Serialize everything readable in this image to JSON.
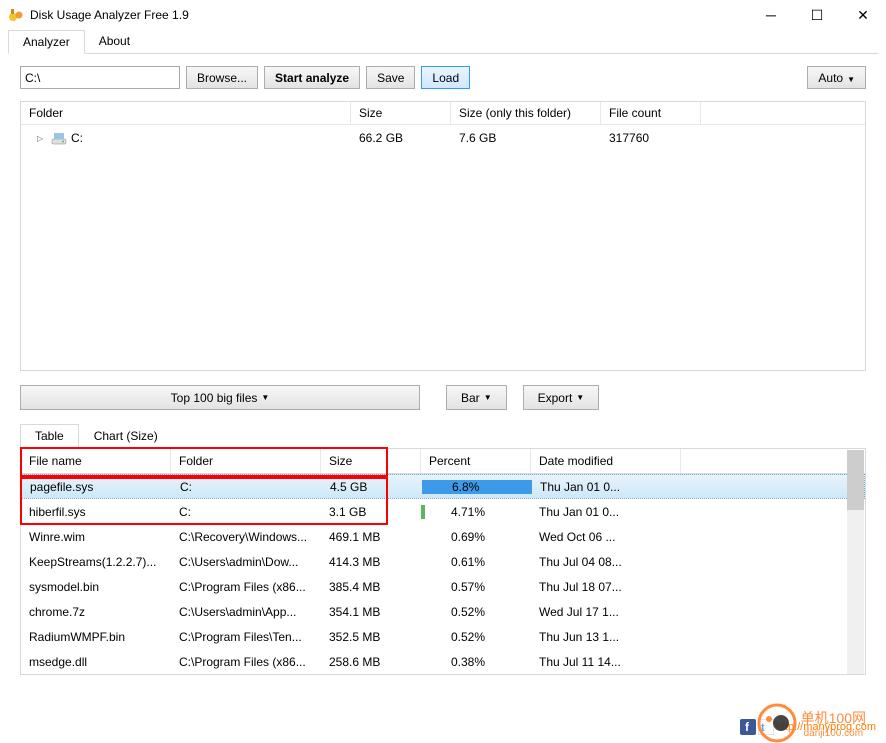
{
  "title": "Disk Usage Analyzer Free 1.9",
  "tabs": {
    "analyzer": "Analyzer",
    "about": "About"
  },
  "toolbar": {
    "path": "C:\\",
    "browse": "Browse...",
    "start": "Start analyze",
    "save": "Save",
    "load": "Load",
    "auto": "Auto"
  },
  "tree": {
    "headers": [
      "Folder",
      "Size",
      "Size (only this folder)",
      "File count"
    ],
    "rows": [
      {
        "name": "C:",
        "size": "66.2 GB",
        "own": "7.6 GB",
        "count": "317760"
      }
    ]
  },
  "mid": {
    "top100": "Top 100 big files",
    "bar": "Bar",
    "export": "Export"
  },
  "subtabs": {
    "table": "Table",
    "chart": "Chart (Size)"
  },
  "table": {
    "headers": {
      "fn": "File name",
      "fo": "Folder",
      "sz": "Size",
      "pc": "Percent",
      "dt": "Date modified"
    },
    "rows": [
      {
        "fn": "pagefile.sys",
        "fo": "C:",
        "sz": "4.5 GB",
        "pc": "6.8%",
        "pcw": 100,
        "bar": "blue",
        "dt": "Thu Jan 01 0...",
        "sel": true
      },
      {
        "fn": "hiberfil.sys",
        "fo": "C:",
        "sz": "3.1 GB",
        "pc": "4.71%",
        "pcw": 4,
        "bar": "green",
        "dt": "Thu Jan 01 0..."
      },
      {
        "fn": "Winre.wim",
        "fo": "C:\\Recovery\\Windows...",
        "sz": "469.1 MB",
        "pc": "0.69%",
        "pcw": 0,
        "dt": "Wed Oct 06 ..."
      },
      {
        "fn": "KeepStreams(1.2.2.7)...",
        "fo": "C:\\Users\\admin\\Dow...",
        "sz": "414.3 MB",
        "pc": "0.61%",
        "pcw": 0,
        "dt": "Thu Jul 04 08..."
      },
      {
        "fn": "sysmodel.bin",
        "fo": "C:\\Program Files (x86...",
        "sz": "385.4 MB",
        "pc": "0.57%",
        "pcw": 0,
        "dt": "Thu Jul 18 07..."
      },
      {
        "fn": "chrome.7z",
        "fo": "C:\\Users\\admin\\App...",
        "sz": "354.1 MB",
        "pc": "0.52%",
        "pcw": 0,
        "dt": "Wed Jul 17 1..."
      },
      {
        "fn": "RadiumWMPF.bin",
        "fo": "C:\\Program Files\\Ten...",
        "sz": "352.5 MB",
        "pc": "0.52%",
        "pcw": 0,
        "dt": "Thu Jun 13 1..."
      },
      {
        "fn": "msedge.dll",
        "fo": "C:\\Program Files (x86...",
        "sz": "258.6 MB",
        "pc": "0.38%",
        "pcw": 0,
        "dt": "Thu Jul 11 14..."
      }
    ]
  },
  "footer": {
    "link": "http://manyprog.com"
  },
  "watermark": {
    "top": "单机100网",
    "bottom": "danji100.com"
  }
}
